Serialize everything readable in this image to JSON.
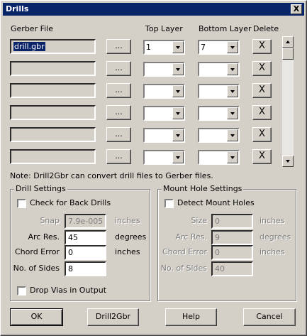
{
  "window": {
    "title": "Drills",
    "close_label": "X"
  },
  "columns": {
    "gerber_file": "Gerber File",
    "top_layer": "Top Layer",
    "bottom_layer": "Bottom Layer",
    "delete": "Delete"
  },
  "rows": [
    {
      "file": "drill.gbr",
      "browse": "...",
      "top": "1",
      "bottom": "7",
      "delete": "X"
    },
    {
      "file": "",
      "browse": "...",
      "top": "",
      "bottom": "",
      "delete": "X"
    },
    {
      "file": "",
      "browse": "...",
      "top": "",
      "bottom": "",
      "delete": "X"
    },
    {
      "file": "",
      "browse": "...",
      "top": "",
      "bottom": "",
      "delete": "X"
    },
    {
      "file": "",
      "browse": "...",
      "top": "",
      "bottom": "",
      "delete": "X"
    },
    {
      "file": "",
      "browse": "...",
      "top": "",
      "bottom": "",
      "delete": "X"
    }
  ],
  "note": "Note:  Drill2Gbr can convert drill files to Gerber files.",
  "drill_settings": {
    "title": "Drill Settings",
    "check_back_drills": {
      "label": "Check for Back Drills",
      "checked": false
    },
    "snap": {
      "label": "Snap",
      "value": "7.9e-005",
      "unit": "inches"
    },
    "arc_res": {
      "label": "Arc Res.",
      "value": "45",
      "unit": "degrees"
    },
    "chord_error": {
      "label": "Chord Error",
      "value": "0",
      "unit": "inches"
    },
    "sides": {
      "label": "No. of Sides",
      "value": "8"
    },
    "drop_vias": {
      "label": "Drop Vias in Output",
      "checked": false
    }
  },
  "mount_settings": {
    "title": "Mount Hole Settings",
    "detect": {
      "label": "Detect Mount Holes",
      "checked": false
    },
    "size": {
      "label": "Size",
      "value": "0",
      "unit": "inches"
    },
    "arc_res": {
      "label": "Arc Res.",
      "value": "9",
      "unit": "degrees"
    },
    "chord_error": {
      "label": "Chord Error",
      "value": "0",
      "unit": "inches"
    },
    "sides": {
      "label": "No. of Sides",
      "value": "40"
    }
  },
  "buttons": {
    "ok": "OK",
    "drill2gbr": "Drill2Gbr",
    "help": "Help",
    "cancel": "Cancel"
  }
}
